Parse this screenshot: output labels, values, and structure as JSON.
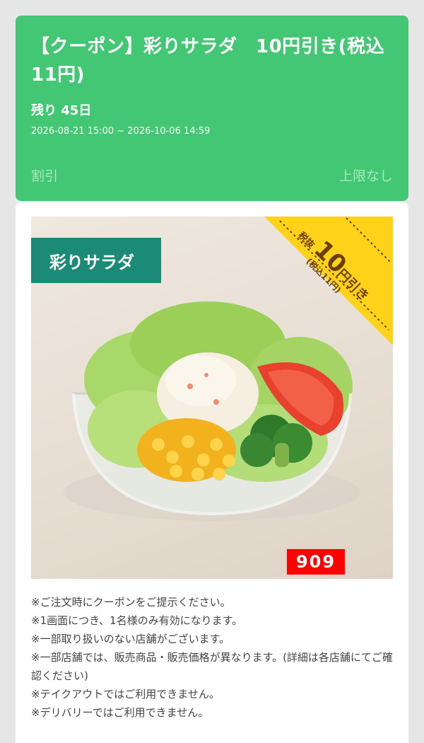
{
  "coupon": {
    "title": "【クーポン】彩りサラダ　10円引き(税込11円)",
    "remaining": "残り 45日",
    "period": "2026-08-21 15:00 ~ 2026-10-06 14:59",
    "kind": "割引",
    "limit": "上限なし"
  },
  "product": {
    "tag": "彩りサラダ",
    "price_code": "909",
    "ribbon": {
      "pre": "税抜",
      "amount": "10",
      "unit": "円引き",
      "tax": "(税込11円)"
    }
  },
  "notes": [
    "※ご注文時にクーポンをご提示ください。",
    "※1画面につき、1名様のみ有効になります。",
    "※一部取り扱いのない店舗がございます。",
    "※一部店舗では、販売商品・販売価格が異なります。(詳細は各店舗にてご確認ください)",
    "※テイクアウトではご利用できません。",
    "※デリバリーではご利用できません。"
  ],
  "colors": {
    "header_green": "#43c774",
    "tag_teal": "#1b8a76",
    "ribbon_yellow": "#ffd21a",
    "price_red": "#ff0000"
  }
}
